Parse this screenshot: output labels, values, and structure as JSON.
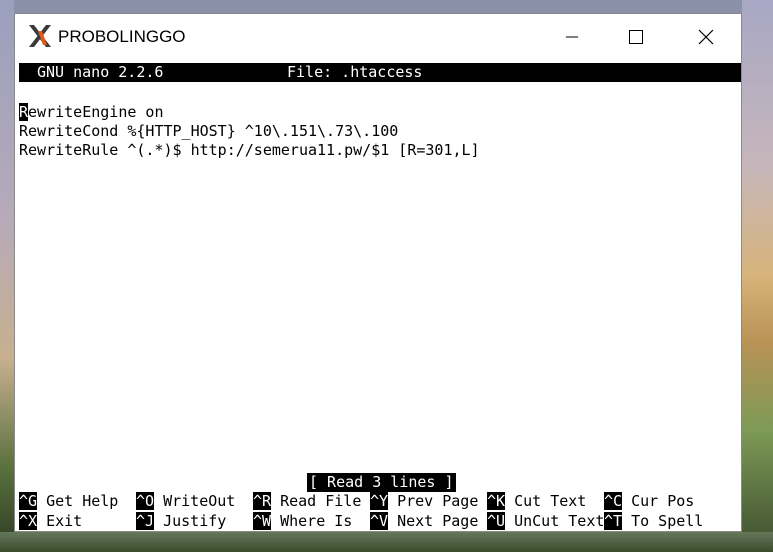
{
  "window": {
    "title": "PROBOLINGGO",
    "minimize_glyph": "—",
    "maximize_glyph": "☐",
    "close_glyph": "✕"
  },
  "nano": {
    "version": "GNU nano 2.2.6",
    "file": "File: .htaccess",
    "lines": [
      "RewriteEngine on",
      "RewriteCond %{HTTP_HOST} ^10\\.151\\.73\\.100",
      "RewriteRule ^(.*)$ http://semerua11.pw/$1 [R=301,L]"
    ],
    "cursor_char": "R",
    "line1_rest": "ewriteEngine on",
    "message": "[ Read 3 lines ]"
  },
  "shortcuts": [
    {
      "key": "^G",
      "label": " Get Help"
    },
    {
      "key": "^O",
      "label": " WriteOut"
    },
    {
      "key": "^R",
      "label": " Read File"
    },
    {
      "key": "^Y",
      "label": " Prev Page"
    },
    {
      "key": "^K",
      "label": " Cut Text"
    },
    {
      "key": "^C",
      "label": " Cur Pos"
    },
    {
      "key": "^X",
      "label": " Exit"
    },
    {
      "key": "^J",
      "label": " Justify"
    },
    {
      "key": "^W",
      "label": " Where Is"
    },
    {
      "key": "^V",
      "label": " Next Page"
    },
    {
      "key": "^U",
      "label": " UnCut Text"
    },
    {
      "key": "^T",
      "label": " To Spell"
    }
  ],
  "colors": {
    "app_icon_primary": "#3a3a3a",
    "app_icon_accent": "#e05a1a"
  },
  "icons": {
    "app": "x-server-icon",
    "minimize": "minimize-icon",
    "maximize": "maximize-icon",
    "close": "close-icon"
  }
}
